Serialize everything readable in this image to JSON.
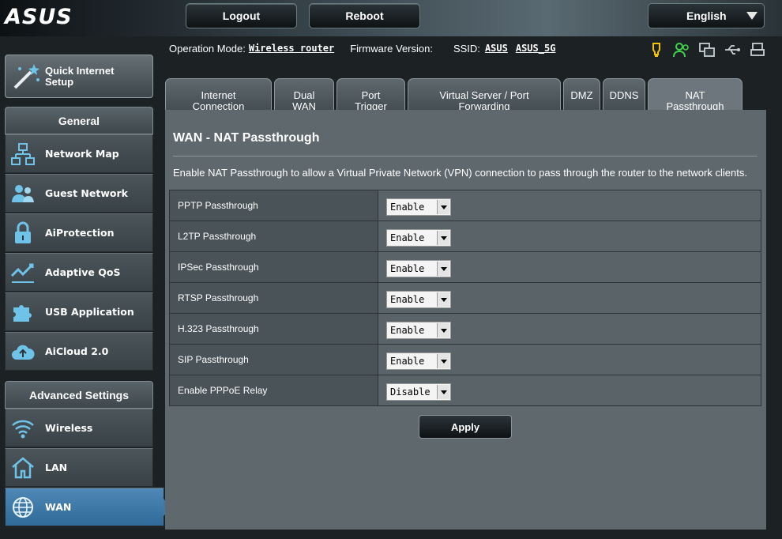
{
  "header": {
    "logo": "ASUS",
    "logout_label": "Logout",
    "reboot_label": "Reboot",
    "language": "English"
  },
  "status": {
    "operation_mode_label": "Operation Mode:",
    "operation_mode_value": "Wireless router",
    "firmware_label": "Firmware Version:",
    "ssid_label": "SSID:",
    "ssid_1": "ASUS",
    "ssid_2": "ASUS_5G"
  },
  "sidebar": {
    "quick_setup_line1": "Quick Internet",
    "quick_setup_line2": "Setup",
    "general_heading": "General",
    "general_items": [
      {
        "label": "Network Map",
        "icon": "network-map-icon"
      },
      {
        "label": "Guest Network",
        "icon": "guest-network-icon"
      },
      {
        "label": "AiProtection",
        "icon": "lock-icon"
      },
      {
        "label": "Adaptive QoS",
        "icon": "qos-icon"
      },
      {
        "label": "USB Application",
        "icon": "puzzle-icon"
      },
      {
        "label": "AiCloud 2.0",
        "icon": "cloud-icon"
      }
    ],
    "advanced_heading": "Advanced Settings",
    "advanced_items": [
      {
        "label": "Wireless",
        "icon": "wifi-icon"
      },
      {
        "label": "LAN",
        "icon": "home-icon"
      },
      {
        "label": "WAN",
        "icon": "globe-icon"
      }
    ]
  },
  "tabs": [
    {
      "line1": "Internet",
      "line2": "Connection"
    },
    {
      "line1": "Dual",
      "line2": "WAN"
    },
    {
      "line1": "Port",
      "line2": "Trigger"
    },
    {
      "line1": "Virtual Server / Port",
      "line2": "Forwarding"
    },
    {
      "line1": "DMZ",
      "line2": ""
    },
    {
      "line1": "DDNS",
      "line2": ""
    },
    {
      "line1": "NAT",
      "line2": "Passthrough"
    }
  ],
  "page": {
    "title": "WAN - NAT Passthrough",
    "description": "Enable NAT Passthrough to allow a Virtual Private Network (VPN) connection to pass through the router to the network clients.",
    "rows": [
      {
        "label": "PPTP Passthrough",
        "value": "Enable"
      },
      {
        "label": "L2TP Passthrough",
        "value": "Enable"
      },
      {
        "label": "IPSec Passthrough",
        "value": "Enable"
      },
      {
        "label": "RTSP Passthrough",
        "value": "Enable"
      },
      {
        "label": "H.323 Passthrough",
        "value": "Enable"
      },
      {
        "label": "SIP Passthrough",
        "value": "Enable"
      },
      {
        "label": "Enable PPPoE Relay",
        "value": "Disable"
      }
    ],
    "apply_label": "Apply"
  },
  "colors": {
    "panel_bg": "#5e686d",
    "active_menu": "#3d7aaa",
    "accent_icon": "#6fc3e8"
  }
}
